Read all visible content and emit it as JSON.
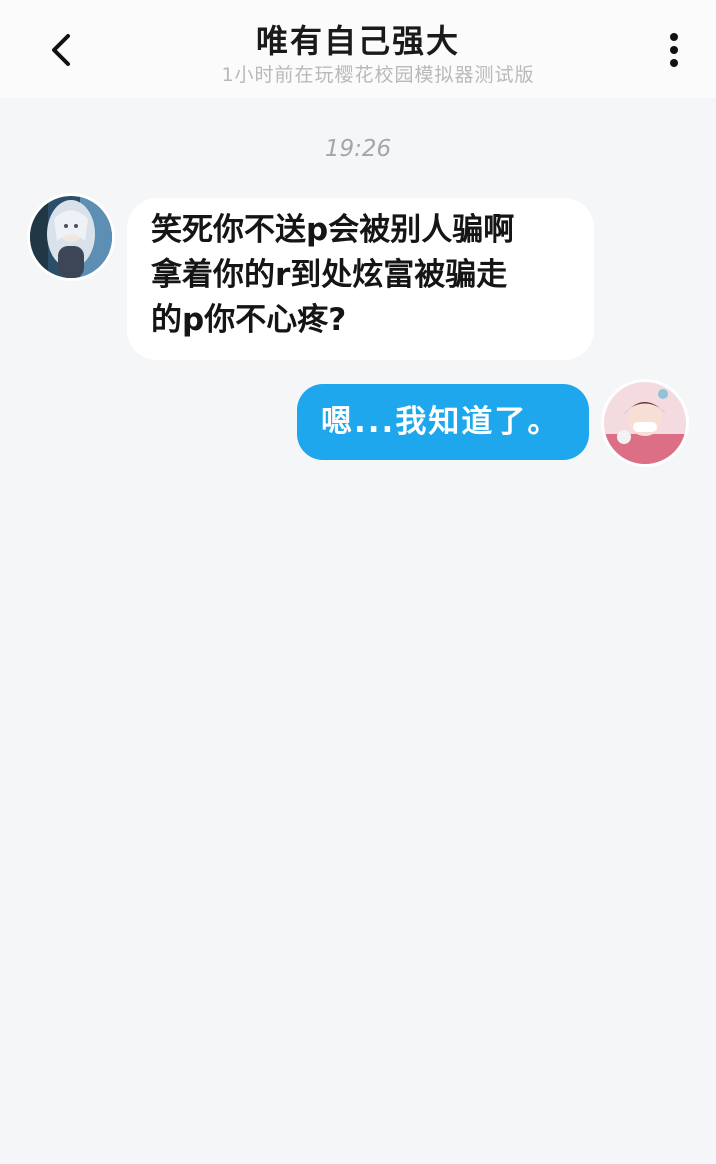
{
  "header": {
    "title": "唯有自己强大",
    "subtitle": "1小时前在玩樱花校园模拟器测试版",
    "back_icon": "chevron-left-icon",
    "more_icon": "more-vertical-icon"
  },
  "chat": {
    "timestamp": "19:26",
    "messages": [
      {
        "side": "left",
        "text": "笑死你不送p会被别人骗啊\n拿着你的r到处炫富被骗走\n的p你不心疼?"
      },
      {
        "side": "right",
        "text": "嗯...我知道了。"
      }
    ]
  },
  "colors": {
    "accent": "#1ea7ec",
    "background": "#f4f6f8",
    "header_bg": "#fbfbfb"
  }
}
